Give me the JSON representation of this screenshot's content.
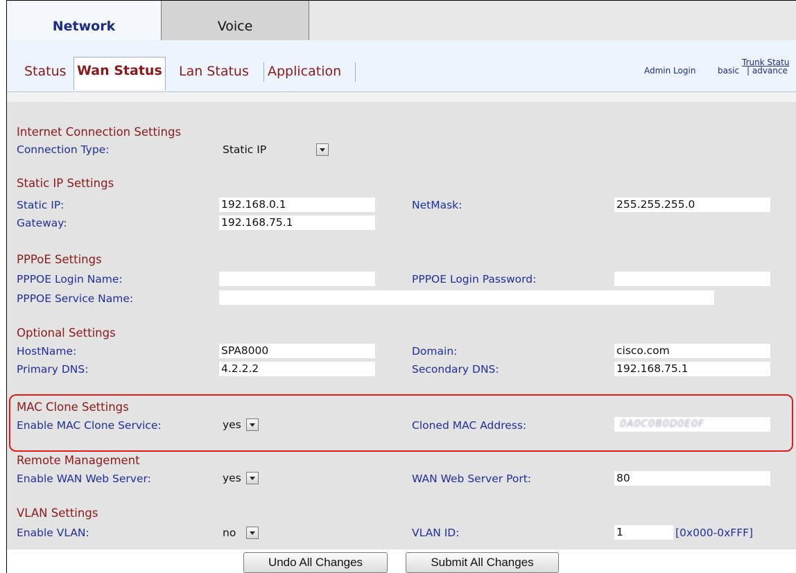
{
  "top_tabs": {
    "network": "Network",
    "voice": "Voice"
  },
  "sub_tabs": {
    "status": "Status",
    "wan_status": "Wan Status",
    "lan_status": "Lan Status",
    "application": "Application"
  },
  "top_links": {
    "trunk_status": "Trunk Statu",
    "admin_login": "Admin Login",
    "basic": "basic",
    "advanced": "| advance"
  },
  "sections": {
    "internet": {
      "title": "Internet Connection Settings",
      "connection_type_label": "Connection Type:",
      "connection_type_value": "Static IP"
    },
    "static_ip": {
      "title": "Static IP Settings",
      "static_ip_label": "Static IP:",
      "static_ip_value": "192.168.0.1",
      "netmask_label": "NetMask:",
      "netmask_value": "255.255.255.0",
      "gateway_label": "Gateway:",
      "gateway_value": "192.168.75.1"
    },
    "pppoe": {
      "title": "PPPoE Settings",
      "login_name_label": "PPPOE Login Name:",
      "login_name_value": "",
      "login_password_label": "PPPOE Login Password:",
      "login_password_value": "",
      "service_name_label": "PPPOE Service Name:",
      "service_name_value": ""
    },
    "optional": {
      "title": "Optional Settings",
      "hostname_label": "HostName:",
      "hostname_value": "SPA8000",
      "domain_label": "Domain:",
      "domain_value": "cisco.com",
      "primary_dns_label": "Primary DNS:",
      "primary_dns_value": "4.2.2.2",
      "secondary_dns_label": "Secondary DNS:",
      "secondary_dns_value": "192.168.75.1"
    },
    "mac_clone": {
      "title": "MAC Clone Settings",
      "enable_label": "Enable MAC Clone Service:",
      "enable_value": "yes",
      "cloned_mac_label": "Cloned MAC Address:",
      "cloned_mac_value": "0A0C0B0D0E0F"
    },
    "remote": {
      "title": "Remote Management",
      "enable_web_label": "Enable WAN Web Server:",
      "enable_web_value": "yes",
      "port_label": "WAN Web Server Port:",
      "port_value": "80"
    },
    "vlan": {
      "title": "VLAN Settings",
      "enable_label": "Enable VLAN:",
      "enable_value": "no",
      "vlan_id_label": "VLAN ID:",
      "vlan_id_value": "1",
      "vlan_id_range": "[0x000-0xFFF]"
    }
  },
  "buttons": {
    "undo": "Undo All Changes",
    "submit": "Submit All Changes"
  },
  "colors": {
    "section_title": "#8a1a1a",
    "label": "#1f2f99",
    "highlight": "#e21a1a",
    "content_bg": "#e3e3e3"
  }
}
